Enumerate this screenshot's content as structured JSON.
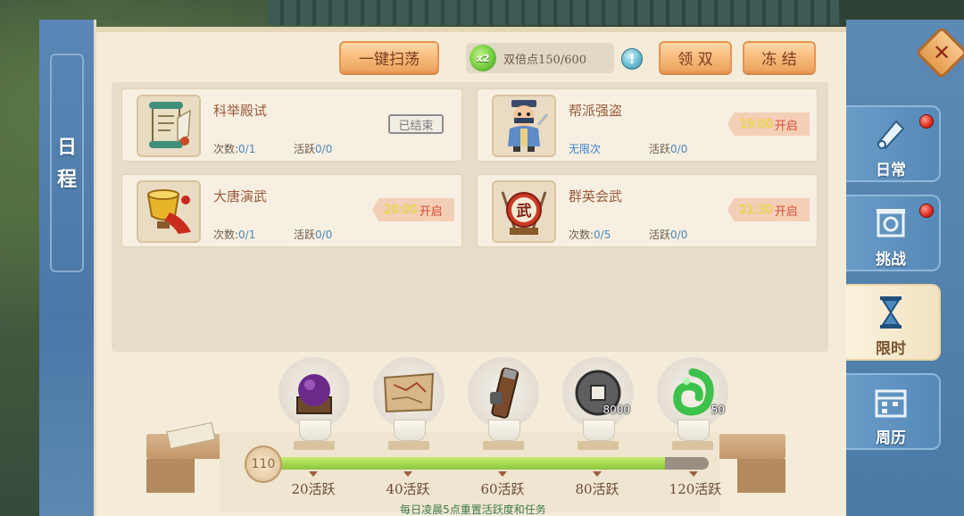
{
  "panel": {
    "title_chars": [
      "日",
      "程"
    ],
    "sweep_button": "一键扫荡",
    "double": {
      "badge": "x2",
      "label": "双倍点150/600",
      "info": "!"
    },
    "claim_double_button": "领 双",
    "freeze_button": "冻 结"
  },
  "events": [
    {
      "name": "科举殿试",
      "count_label": "次数:",
      "count_value": "0/1",
      "active_label": "活跃",
      "active_value": "0/0",
      "status": "已结束"
    },
    {
      "name": "帮派强盗",
      "count_label": "",
      "count_value": "无限次",
      "active_label": "活跃",
      "active_value": "0/0",
      "open_time": "19:00",
      "open_suffix": "开启"
    },
    {
      "name": "大唐演武",
      "count_label": "次数:",
      "count_value": "0/1",
      "active_label": "活跃",
      "active_value": "0/0",
      "open_time": "20:00",
      "open_suffix": "开启"
    },
    {
      "name": "群英会武",
      "count_label": "次数:",
      "count_value": "0/5",
      "active_label": "活跃",
      "active_value": "0/0",
      "open_time": "21:30",
      "open_suffix": "开启",
      "emblem": "武"
    }
  ],
  "rewards": [
    {
      "icon": "purple-orb-icon",
      "amount": ""
    },
    {
      "icon": "map-scroll-icon",
      "amount": ""
    },
    {
      "icon": "quiver-icon",
      "amount": ""
    },
    {
      "icon": "copper-coin-icon",
      "amount": "8000"
    },
    {
      "icon": "jade-pendant-icon",
      "amount": "50"
    }
  ],
  "progress": {
    "current": "110",
    "fraction": 0.9,
    "milestones": [
      "20活跃",
      "40活跃",
      "60活跃",
      "80活跃",
      "120活跃"
    ]
  },
  "footer_note": "每日凌晨5点重置活跃度和任务",
  "tabs": [
    {
      "label": "日常",
      "icon": "scroll-icon",
      "badge": true
    },
    {
      "label": "挑战",
      "icon": "arena-icon",
      "badge": true
    },
    {
      "label": "限时",
      "icon": "hourglass-icon",
      "badge": false,
      "active": true
    },
    {
      "label": "周历",
      "icon": "calendar-icon",
      "badge": false
    }
  ],
  "colors": {
    "panel_bg": "#f4ecd9",
    "accent_orange": "#f6b97a",
    "tab_blue": "#5589b7",
    "progress_green": "#8bc73a",
    "open_time_yellow": "#f2e73f",
    "open_red": "#d94b33"
  }
}
